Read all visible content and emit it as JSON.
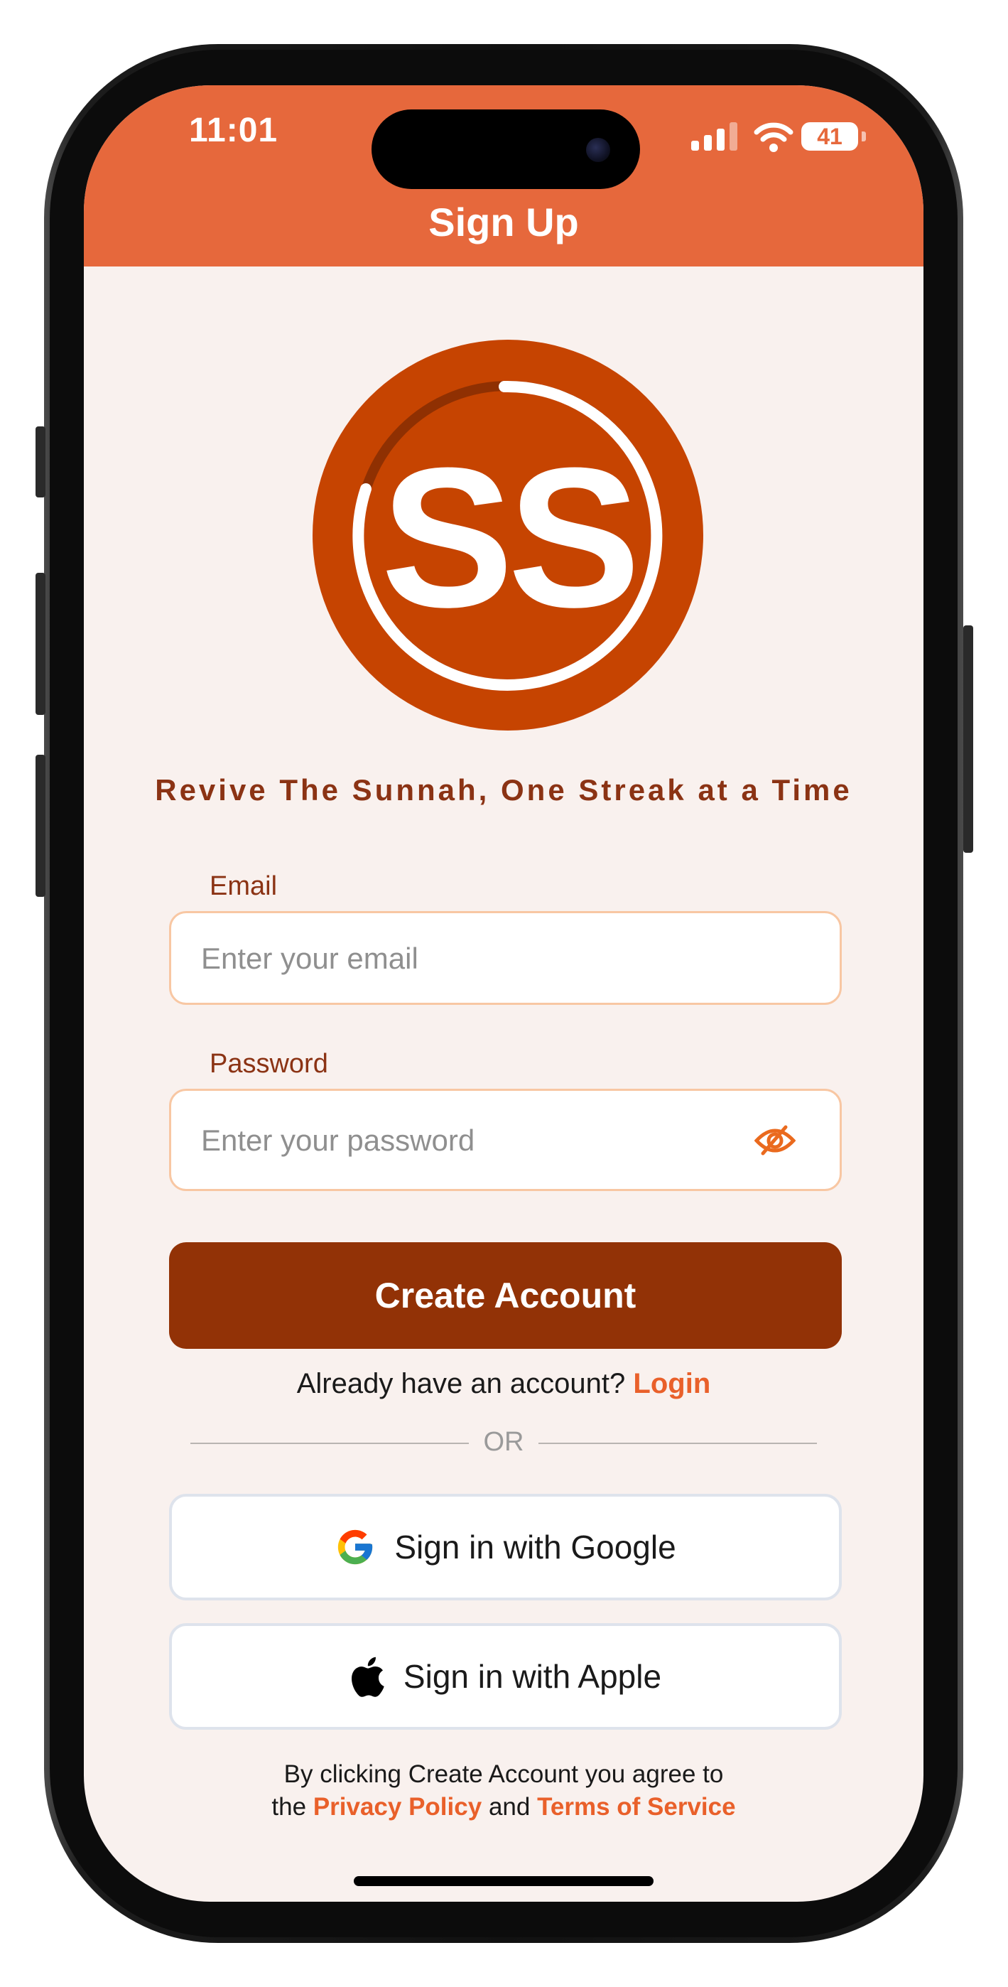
{
  "status_bar": {
    "time": "11:01",
    "battery": "41",
    "icons": [
      "signal-icon",
      "wifi-icon",
      "battery-icon"
    ]
  },
  "header": {
    "title": "Sign Up"
  },
  "logo": {
    "text": "SS"
  },
  "tagline": "Revive The Sunnah, One Streak at a Time",
  "form": {
    "email": {
      "label": "Email",
      "placeholder": "Enter your email",
      "value": ""
    },
    "password": {
      "label": "Password",
      "placeholder": "Enter your password",
      "value": "",
      "toggle_icon": "eye-slash-icon"
    },
    "submit_label": "Create Account"
  },
  "login_prompt": {
    "text": "Already have an account?",
    "link": "Login"
  },
  "divider": "OR",
  "social": {
    "google_label": "Sign in with Google",
    "apple_label": "Sign in with Apple"
  },
  "legal": {
    "line1": "By clicking Create Account you agree to",
    "prefix": "the",
    "privacy": "Privacy Policy",
    "and": "and",
    "terms": "Terms of Service"
  },
  "colors": {
    "brand_orange": "#e6683c",
    "primary_button": "#923206",
    "link": "#e9602a",
    "background": "#f9f1ee"
  }
}
